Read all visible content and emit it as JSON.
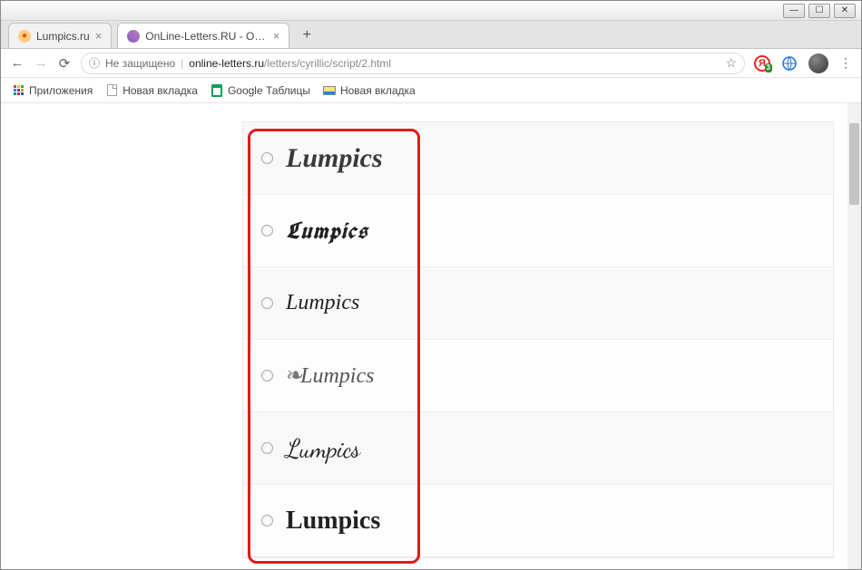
{
  "window": {
    "btn_min": "—",
    "btn_max": "☐",
    "btn_close": "✕"
  },
  "tabs": [
    {
      "title": "Lumpics.ru",
      "favicon_color": "#ff9800",
      "active": false
    },
    {
      "title": "OnLine-Letters.RU - Онлайн ген...",
      "favicon_color": "#6a4fb3",
      "active": true
    }
  ],
  "toolbar": {
    "back": "←",
    "forward": "→",
    "reload": "⟳",
    "security_icon": "ⓘ",
    "security_text": "Не защищено",
    "url_host": "online-letters.ru",
    "url_path": "/letters/cyrillic/script/2.html",
    "star": "☆",
    "ext_yandex_letter": "Я",
    "ext_yandex_badge": "3",
    "menu": "⋮"
  },
  "bookmarks": [
    {
      "label": "Приложения",
      "icon": "apps"
    },
    {
      "label": "Новая вкладка",
      "icon": "doc"
    },
    {
      "label": "Google Таблицы",
      "icon": "sheets"
    },
    {
      "label": "Новая вкладка",
      "icon": "pic"
    }
  ],
  "fonts": [
    {
      "sample": "Lumpics"
    },
    {
      "sample": "Lumpics"
    },
    {
      "sample": "Lumpics"
    },
    {
      "sample": "Lumpics"
    },
    {
      "sample": "Lumpics"
    },
    {
      "sample": "Lumpics"
    }
  ]
}
